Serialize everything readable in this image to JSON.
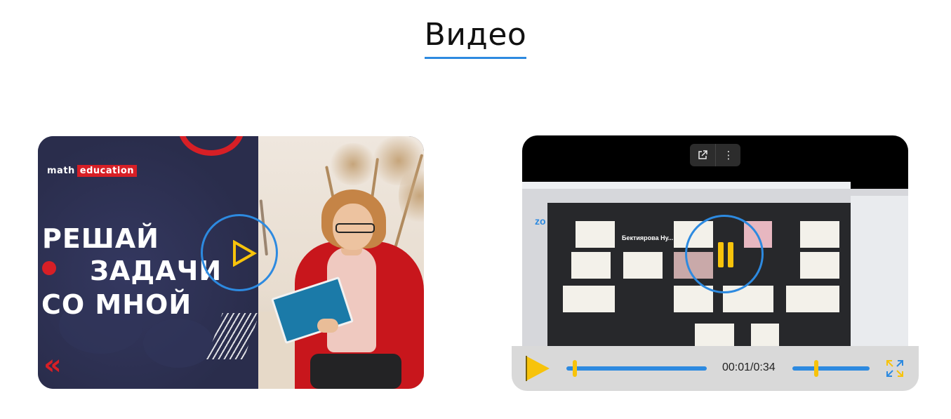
{
  "section": {
    "title": "Видео"
  },
  "video1": {
    "brand_prefix": "math",
    "brand_tag": "education",
    "headline_line1": "РЕШАЙ",
    "headline_line2": "ЗАДАЧИ",
    "headline_line3": "СО МНОЙ",
    "chevron_symbol": "«",
    "play_icon": "play-outline-icon"
  },
  "video2": {
    "toolbar": {
      "share_icon": "open-external-icon",
      "menu_icon": "more-vertical-icon",
      "menu_glyph": "⋮"
    },
    "zoom_label": "zo",
    "speaker_name": "Бектиярова Ну...",
    "state_icon": "pause-icon",
    "player": {
      "time": "00:01/0:34",
      "progress": 0.06,
      "volume": 0.31,
      "play_icon": "play-icon",
      "fullscreen_icon": "fullscreen-icon"
    }
  },
  "colors": {
    "accent": "#2d8ae0",
    "yellow": "#f7c30b",
    "brand_red": "#d71f26",
    "navy": "#2b2e4f"
  }
}
